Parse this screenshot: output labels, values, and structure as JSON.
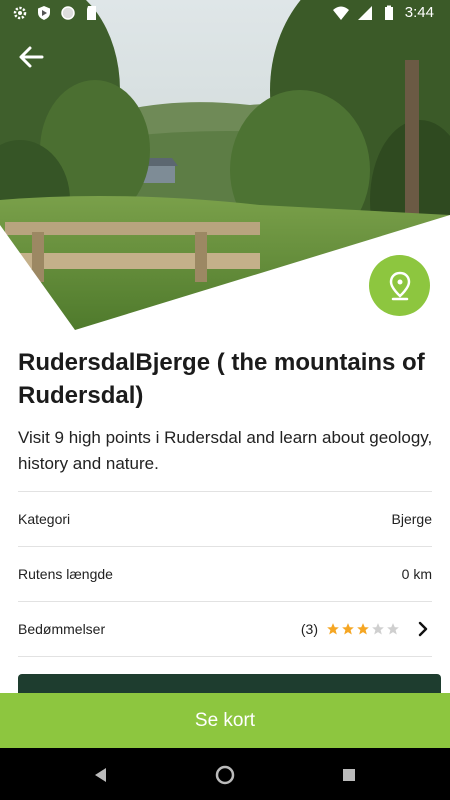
{
  "status_bar": {
    "time": "3:44",
    "left_icons": [
      "settings-icon",
      "shield-icon",
      "circle-icon",
      "sd-card-icon"
    ],
    "right_icons": [
      "wifi-icon",
      "signal-icon",
      "battery-icon"
    ]
  },
  "header": {
    "back_icon": "arrow-left-icon",
    "badge_icon": "location-pin-icon"
  },
  "route": {
    "title": "RudersdalBjerge ( the mountains of Rudersdal)",
    "description": "Visit 9 high points i Rudersdal and learn about geology, history and nature."
  },
  "details": {
    "category_label": "Kategori",
    "category_value": "Bjerge",
    "length_label": "Rutens længde",
    "length_value": "0 km",
    "ratings_label": "Bedømmelser",
    "ratings_count": "(3)",
    "rating_stars": 3,
    "rating_max": 5
  },
  "actions": {
    "see_map_label": "Se kort"
  },
  "colors": {
    "accent": "#8dc63f",
    "dark_button": "#1e3d2f",
    "star_filled": "#f5a623",
    "star_empty": "#cfcfcf"
  }
}
